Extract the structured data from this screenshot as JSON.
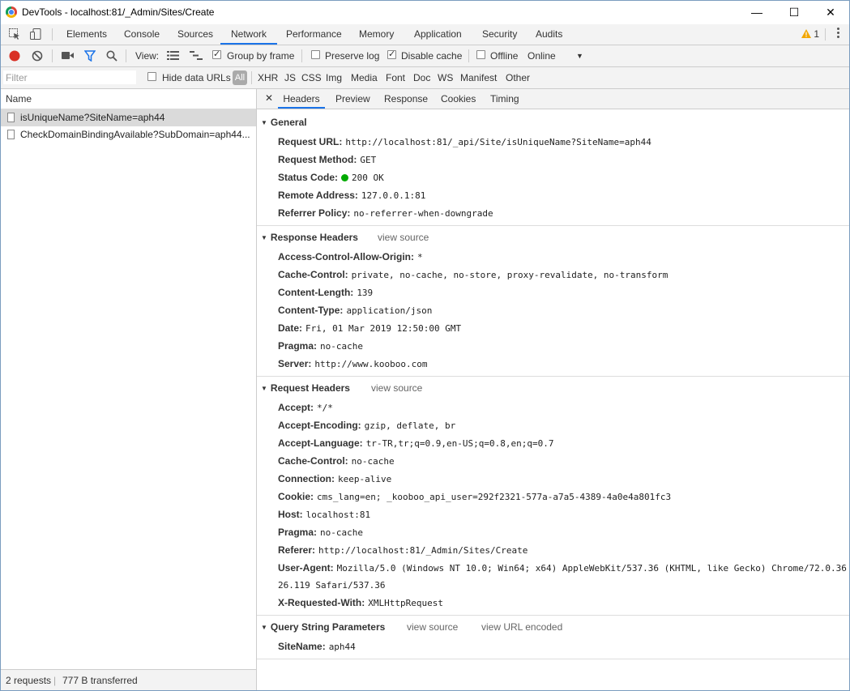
{
  "window": {
    "title": "DevTools - localhost:81/_Admin/Sites/Create",
    "minimize": "—",
    "maximize": "☐",
    "close": "✕"
  },
  "main_tabs": [
    "Elements",
    "Console",
    "Sources",
    "Network",
    "Performance",
    "Memory",
    "Application",
    "Security",
    "Audits"
  ],
  "active_tab": "Network",
  "warning_count": "1",
  "toolbar": {
    "view_label": "View:",
    "group_by_frame": "Group by frame",
    "preserve_log": "Preserve log",
    "disable_cache": "Disable cache",
    "offline": "Offline",
    "throttle": "Online"
  },
  "filterbar": {
    "placeholder": "Filter",
    "hide_data_urls": "Hide data URLs",
    "all": "All",
    "types": [
      "XHR",
      "JS",
      "CSS",
      "Img",
      "Media",
      "Font",
      "Doc",
      "WS",
      "Manifest",
      "Other"
    ]
  },
  "requests": {
    "header": "Name",
    "items": [
      "isUniqueName?SiteName=aph44",
      "CheckDomainBindingAvailable?SubDomain=aph44..."
    ]
  },
  "status": {
    "requests": "2 requests",
    "transferred": "777 B transferred"
  },
  "detail_tabs": [
    "Headers",
    "Preview",
    "Response",
    "Cookies",
    "Timing"
  ],
  "general": {
    "title": "General",
    "rows": [
      {
        "k": "Request URL:",
        "v": "http://localhost:81/_api/Site/isUniqueName?SiteName=aph44"
      },
      {
        "k": "Request Method:",
        "v": "GET"
      },
      {
        "k": "Status Code:",
        "v": "200 OK"
      },
      {
        "k": "Remote Address:",
        "v": "127.0.0.1:81"
      },
      {
        "k": "Referrer Policy:",
        "v": "no-referrer-when-downgrade"
      }
    ]
  },
  "response_headers": {
    "title": "Response Headers",
    "view_source": "view source",
    "rows": [
      {
        "k": "Access-Control-Allow-Origin:",
        "v": "*"
      },
      {
        "k": "Cache-Control:",
        "v": "private, no-cache, no-store, proxy-revalidate, no-transform"
      },
      {
        "k": "Content-Length:",
        "v": "139"
      },
      {
        "k": "Content-Type:",
        "v": "application/json"
      },
      {
        "k": "Date:",
        "v": "Fri, 01 Mar 2019 12:50:00 GMT"
      },
      {
        "k": "Pragma:",
        "v": "no-cache"
      },
      {
        "k": "Server:",
        "v": "http://www.kooboo.com"
      }
    ]
  },
  "request_headers": {
    "title": "Request Headers",
    "view_source": "view source",
    "rows": [
      {
        "k": "Accept:",
        "v": "*/*"
      },
      {
        "k": "Accept-Encoding:",
        "v": "gzip, deflate, br"
      },
      {
        "k": "Accept-Language:",
        "v": "tr-TR,tr;q=0.9,en-US;q=0.8,en;q=0.7"
      },
      {
        "k": "Cache-Control:",
        "v": "no-cache"
      },
      {
        "k": "Connection:",
        "v": "keep-alive"
      },
      {
        "k": "Cookie:",
        "v": "cms_lang=en; _kooboo_api_user=292f2321-577a-a7a5-4389-4a0e4a801fc3"
      },
      {
        "k": "Host:",
        "v": "localhost:81"
      },
      {
        "k": "Pragma:",
        "v": "no-cache"
      },
      {
        "k": "Referer:",
        "v": "http://localhost:81/_Admin/Sites/Create"
      },
      {
        "k": "User-Agent:",
        "v": "Mozilla/5.0 (Windows NT 10.0; Win64; x64) AppleWebKit/537.36 (KHTML, like Gecko) Chrome/72.0.36"
      },
      {
        "k": "",
        "v": "26.119 Safari/537.36"
      },
      {
        "k": "X-Requested-With:",
        "v": "XMLHttpRequest"
      }
    ]
  },
  "query_string": {
    "title": "Query String Parameters",
    "view_source": "view source",
    "view_url_encoded": "view URL encoded",
    "rows": [
      {
        "k": "SiteName:",
        "v": "aph44"
      }
    ]
  },
  "colors": {
    "accent": "#1a73e8",
    "record": "#d93025",
    "status_ok": "#00aa00",
    "warning": "#f2a600"
  }
}
